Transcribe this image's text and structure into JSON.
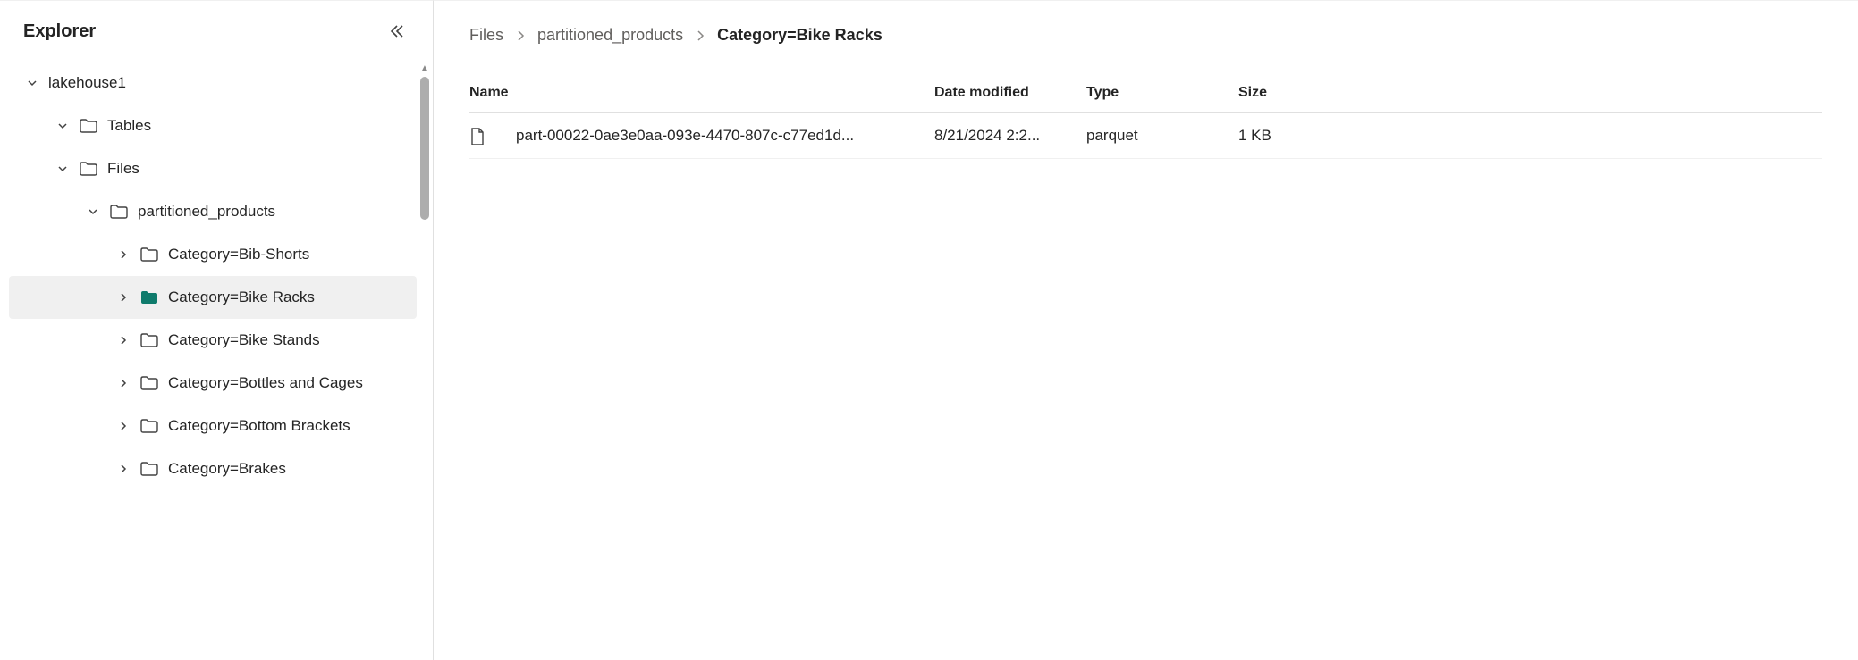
{
  "sidebar": {
    "title": "Explorer",
    "root": "lakehouse1",
    "tables_label": "Tables",
    "files_label": "Files",
    "partitioned_label": "partitioned_products",
    "categories": [
      "Category=Bib-Shorts",
      "Category=Bike Racks",
      "Category=Bike Stands",
      "Category=Bottles and Cages",
      "Category=Bottom Brackets",
      "Category=Brakes"
    ]
  },
  "breadcrumb": {
    "items": [
      "Files",
      "partitioned_products",
      "Category=Bike Racks"
    ]
  },
  "table": {
    "headers": {
      "name": "Name",
      "date": "Date modified",
      "type": "Type",
      "size": "Size"
    },
    "rows": [
      {
        "name": "part-00022-0ae3e0aa-093e-4470-807c-c77ed1d...",
        "date": "8/21/2024 2:2...",
        "type": "parquet",
        "size": "1 KB"
      }
    ]
  }
}
